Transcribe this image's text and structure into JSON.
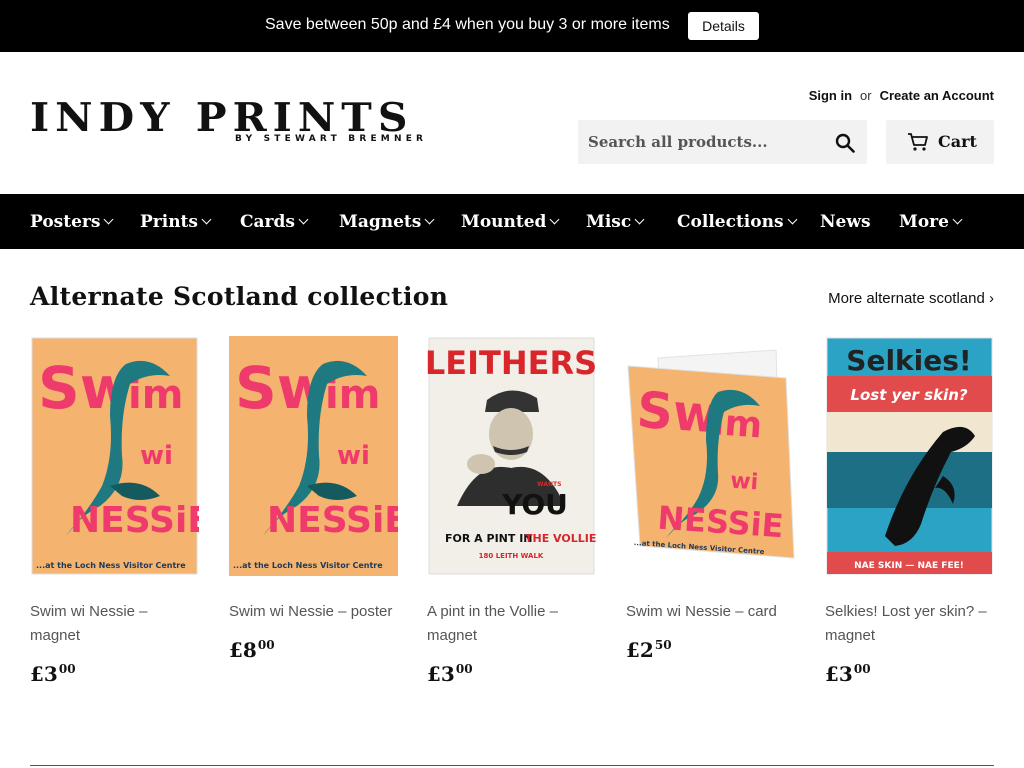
{
  "announcement": {
    "text": "Save between 50p and £4 when you buy 3 or more items",
    "button": "Details"
  },
  "header": {
    "logo_main": "INDY PRINTS",
    "logo_sub": "BY STEWART BREMNER",
    "sign_in": "Sign in",
    "or": "or",
    "create_account": "Create an Account",
    "search_placeholder": "Search all products...",
    "cart_label": "Cart"
  },
  "nav": [
    {
      "label": "Posters"
    },
    {
      "label": "Prints"
    },
    {
      "label": "Cards"
    },
    {
      "label": "Magnets"
    },
    {
      "label": "Mounted"
    },
    {
      "label": "Misc"
    },
    {
      "label": "Collections"
    },
    {
      "label": "News"
    },
    {
      "label": "More"
    }
  ],
  "collection": {
    "title": "Alternate Scotland collection",
    "more_link": "More alternate scotland ›",
    "products": [
      {
        "name": "Swim wi Nessie – magnet",
        "price_main": "£3",
        "price_cents": "00"
      },
      {
        "name": "Swim wi Nessie – poster",
        "price_main": "£8",
        "price_cents": "00"
      },
      {
        "name": "A pint in the Vollie – magnet",
        "price_main": "£3",
        "price_cents": "00"
      },
      {
        "name": "Swim wi Nessie – card",
        "price_main": "£2",
        "price_cents": "50"
      },
      {
        "name": "Selkies! Lost yer skin? – magnet",
        "price_main": "£3",
        "price_cents": "00"
      }
    ]
  },
  "artwork": {
    "nessie_top": "Sw",
    "nessie_top2": "im",
    "nessie_mid": "wi",
    "nessie_bottom": "NESSiE",
    "nessie_caption": "...at the Loch Ness Visitor Centre",
    "leithers_title": "LEITHERS",
    "leithers_wants": "WANTS",
    "leithers_you": "YOU",
    "leithers_line": "FOR A PINT IN",
    "leithers_vollie": "THE VOLLIE!",
    "leithers_address": "180 LEITH WALK",
    "selkies_title": "Selkies!",
    "selkies_sub": "Lost yer skin?",
    "selkies_bottom": "NAE SKIN — NAE FEE!"
  },
  "colors": {
    "bar": "#000000",
    "nessie_bg": "#f4b36e",
    "nessie_red": "#ef3a6c",
    "nessie_teal": "#1e7a80",
    "selkie_blue": "#2aa3c4",
    "selkie_red": "#e24b4b"
  }
}
